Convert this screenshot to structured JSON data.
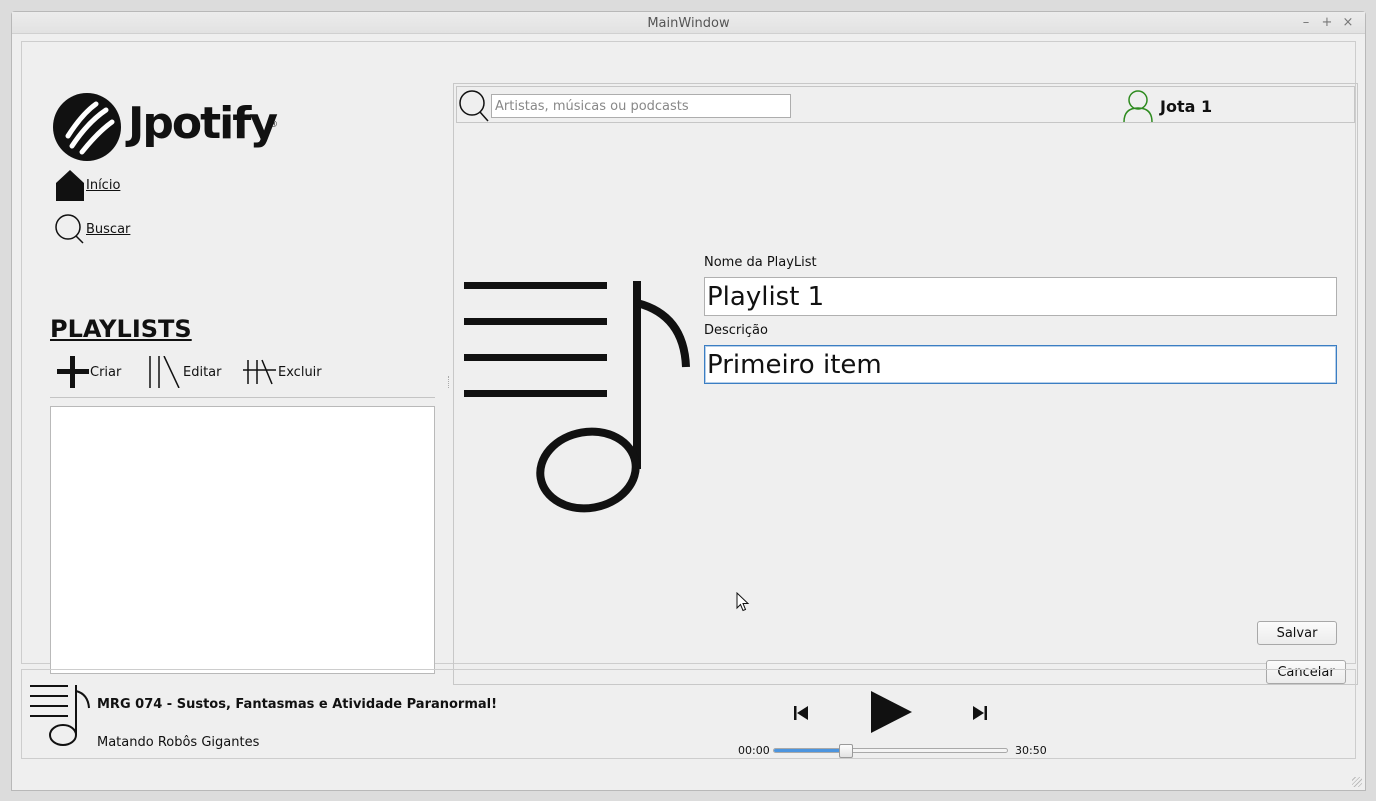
{
  "window": {
    "title": "MainWindow",
    "minimize": "–",
    "maximize": "+",
    "close": "×"
  },
  "brand": {
    "name": "Jpotify",
    "reg": "®"
  },
  "nav": {
    "home": "Início",
    "search": "Buscar"
  },
  "playlists": {
    "title": "PLAYLISTS",
    "create": "Criar",
    "edit": "Editar",
    "delete": "Excluir",
    "items": []
  },
  "topbar": {
    "search_placeholder": "Artistas, músicas ou podcasts",
    "search_value": "",
    "user_name": "Jota 1"
  },
  "form": {
    "name_label": "Nome da PlayList",
    "name_value": "Playlist 1",
    "desc_label": "Descrição",
    "desc_value": "Primeiro item",
    "save": "Salvar",
    "cancel": "Cancelar"
  },
  "player": {
    "title": "MRG 074 - Sustos, Fantasmas e Atividade Paranormal!",
    "artist": "Matando Robôs Gigantes",
    "current_time": "00:00",
    "total_time": "30:50",
    "progress": 0.31
  },
  "colors": {
    "accent": "#4c95df",
    "user_icon": "#2e8b1f",
    "focus": "#3b7ec3"
  }
}
